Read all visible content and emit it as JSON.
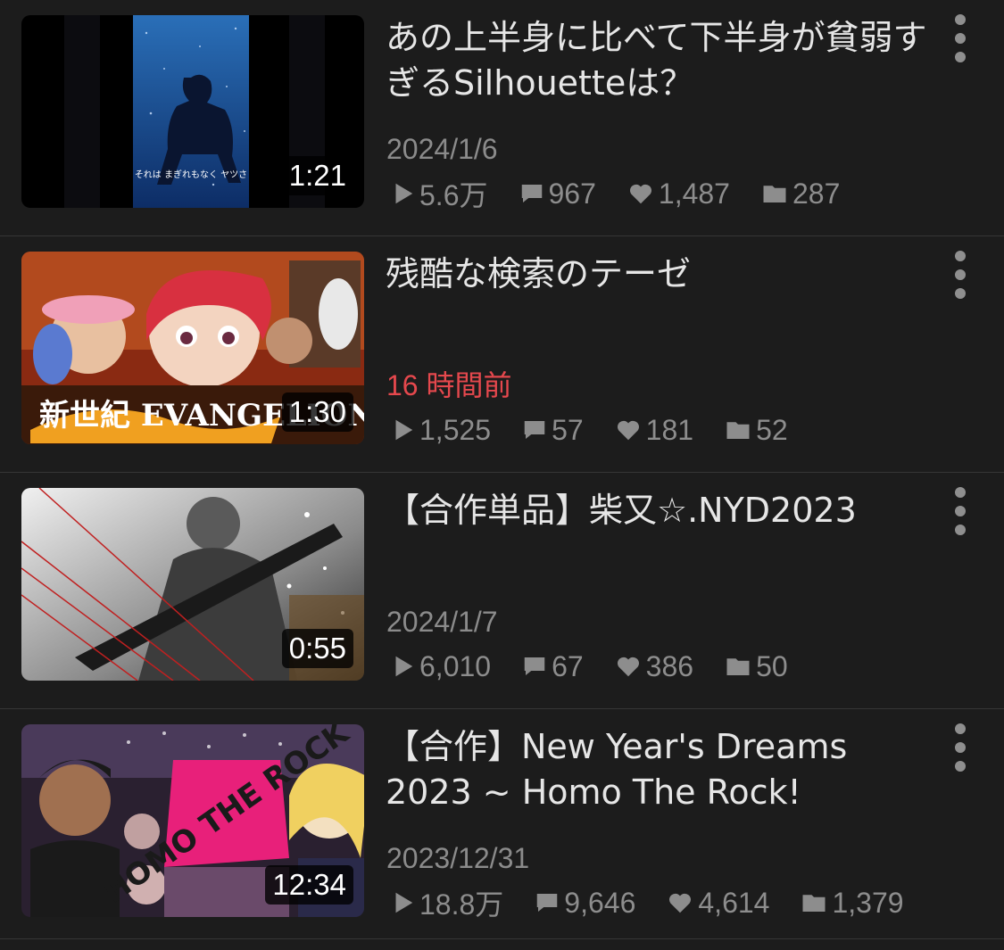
{
  "videos": [
    {
      "title": "あの上半身に比べて下半身が貧弱すぎるSilhouetteは？",
      "date": "2024/1/6",
      "duration": "1:21",
      "thumb_caption": "それは まぎれもなく ヤツさ",
      "views": "5.6万",
      "comments": "967",
      "likes": "1,487",
      "mylists": "287"
    },
    {
      "title": "残酷な検索のテーゼ",
      "date": "16 時間前",
      "duration": "1:30",
      "thumb_caption": "新世紀 EVANGELION",
      "views": "1,525",
      "comments": "57",
      "likes": "181",
      "mylists": "52"
    },
    {
      "title": "【合作単品】柴又☆.NYD2023",
      "date": "2024/1/7",
      "duration": "0:55",
      "views": "6,010",
      "comments": "67",
      "likes": "386",
      "mylists": "50"
    },
    {
      "title": "【合作】New Year's Dreams 2023 ~ Homo The Rock!",
      "date": "2023/12/31",
      "duration": "12:34",
      "thumb_caption": "HOMO THE ROCK",
      "views": "18.8万",
      "comments": "9,646",
      "likes": "4,614",
      "mylists": "1,379"
    }
  ],
  "colors": {
    "background": "#1c1c1c",
    "recent_date": "#e5484d",
    "meta_text": "#8d8d8d"
  },
  "icons": [
    "play-icon",
    "comment-icon",
    "heart-icon",
    "folder-icon",
    "more-vert-icon"
  ]
}
